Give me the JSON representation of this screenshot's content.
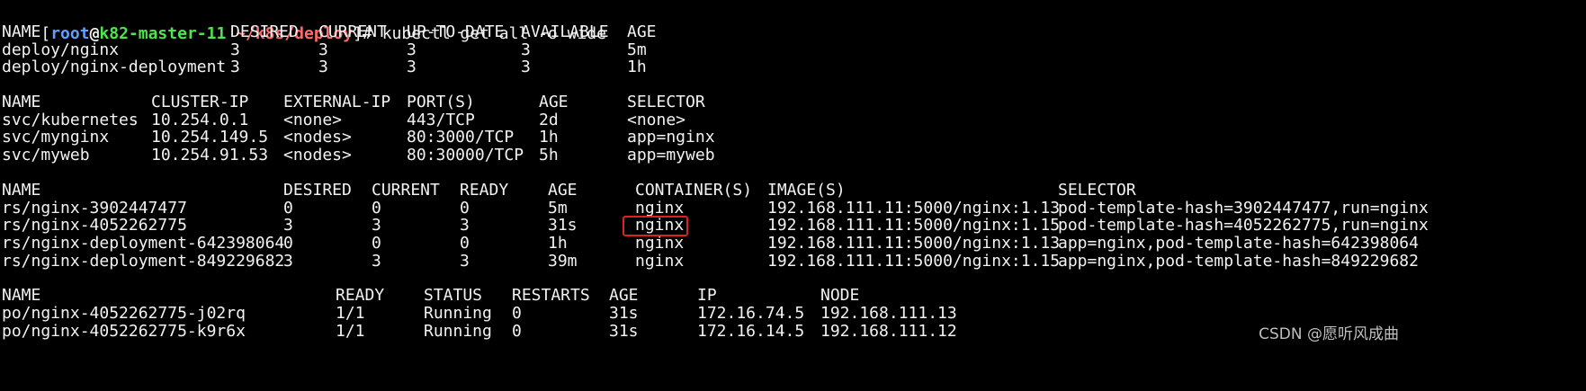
{
  "prompt": {
    "open_bracket": "[",
    "user": "root",
    "at": "@",
    "host": "k82-master-11",
    "path": " ~/k8s/deploy",
    "close_hash": "]# ",
    "command": "kubectl get all -o wide"
  },
  "colors": {
    "background": "#000000",
    "text": "#f2f2f2",
    "user": "#5fa0ff",
    "host": "#4ee44e",
    "path": "#ff6a6a",
    "highlight": "#e02020"
  },
  "deploy_table": {
    "headers": [
      "NAME",
      "DESIRED",
      "CURRENT",
      "UP-TO-DATE",
      "AVAILABLE",
      "AGE"
    ],
    "rows": [
      [
        "deploy/nginx",
        "3",
        "3",
        "3",
        "3",
        "5m"
      ],
      [
        "deploy/nginx-deployment",
        "3",
        "3",
        "3",
        "3",
        "1h"
      ]
    ]
  },
  "svc_table": {
    "headers": [
      "NAME",
      "CLUSTER-IP",
      "EXTERNAL-IP",
      "PORT(S)",
      "AGE",
      "SELECTOR"
    ],
    "rows": [
      [
        "svc/kubernetes",
        "10.254.0.1",
        "<none>",
        "443/TCP",
        "2d",
        "<none>"
      ],
      [
        "svc/mynginx",
        "10.254.149.5",
        "<nodes>",
        "80:3000/TCP",
        "1h",
        "app=nginx"
      ],
      [
        "svc/myweb",
        "10.254.91.53",
        "<nodes>",
        "80:30000/TCP",
        "5h",
        "app=myweb"
      ]
    ]
  },
  "rs_table": {
    "headers": [
      "NAME",
      "DESIRED",
      "CURRENT",
      "READY",
      "AGE",
      "CONTAINER(S)",
      "IMAGE(S)",
      "SELECTOR"
    ],
    "rows": [
      [
        "rs/nginx-3902447477",
        "0",
        "0",
        "0",
        "5m",
        "nginx",
        "192.168.111.11:5000/nginx:1.13",
        "pod-template-hash=3902447477,run=nginx"
      ],
      [
        "rs/nginx-4052262775",
        "3",
        "3",
        "3",
        "31s",
        "nginx",
        "192.168.111.11:5000/nginx:1.15",
        "pod-template-hash=4052262775,run=nginx"
      ],
      [
        "rs/nginx-deployment-642398064",
        "0",
        "0",
        "0",
        "1h",
        "nginx",
        "192.168.111.11:5000/nginx:1.13",
        "app=nginx,pod-template-hash=642398064"
      ],
      [
        "rs/nginx-deployment-849229682",
        "3",
        "3",
        "3",
        "39m",
        "nginx",
        "192.168.111.11:5000/nginx:1.15",
        "app=nginx,pod-template-hash=849229682"
      ]
    ]
  },
  "po_table": {
    "headers": [
      "NAME",
      "READY",
      "STATUS",
      "RESTARTS",
      "AGE",
      "IP",
      "NODE"
    ],
    "rows": [
      [
        "po/nginx-4052262775-j02rq",
        "1/1",
        "Running",
        "0",
        "31s",
        "172.16.74.5",
        "192.168.111.13"
      ],
      [
        "po/nginx-4052262775-k9r6x",
        "1/1",
        "Running",
        "0",
        "31s",
        "172.16.14.5",
        "192.168.111.12"
      ]
    ]
  },
  "watermark": "CSDN @愿听风成曲"
}
